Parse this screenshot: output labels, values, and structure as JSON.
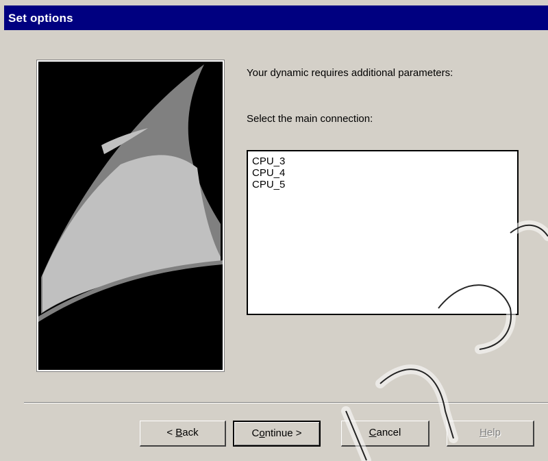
{
  "window": {
    "title": "Set options"
  },
  "main": {
    "intro_text": "Your dynamic requires additional parameters:",
    "select_label": "Select the main connection:",
    "connections": [
      "CPU_3",
      "CPU_4",
      "CPU_5"
    ]
  },
  "buttons": {
    "back": {
      "pre": "< ",
      "mnemonic": "B",
      "post": "ack"
    },
    "continue": {
      "pre": "C",
      "mnemonic": "o",
      "post": "ntinue >"
    },
    "cancel": {
      "pre": "",
      "mnemonic": "C",
      "post": "ancel"
    },
    "help": {
      "pre": "",
      "mnemonic": "H",
      "post": "elp"
    }
  },
  "colors": {
    "title_bar": "#000080",
    "dialog_bg": "#d4d0c8",
    "art_light": "#c0c0c0",
    "art_mid": "#808080"
  }
}
